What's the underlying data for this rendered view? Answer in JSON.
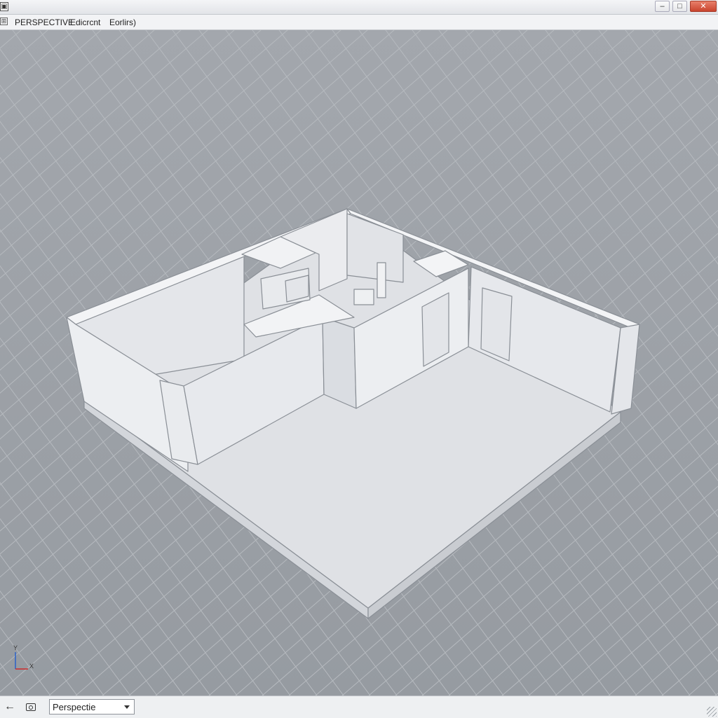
{
  "window": {
    "min_glyph": "‒",
    "max_glyph": "□",
    "close_glyph": "✕"
  },
  "toolbar": {
    "icon_glyph": "⊞",
    "view_name": "PERSPECTIVE",
    "menu_edit": "Edicrcnt",
    "menu_options": "Eorlirs)"
  },
  "viewport": {
    "axis_y": "Y",
    "axis_x": "X",
    "colors": {
      "background": "#9ea3a9",
      "grid_line": "#b6babf",
      "wall": "#e9eaee",
      "floor": "#dfe1e5",
      "edge": "#8a8f96"
    }
  },
  "statusbar": {
    "view_select_value": "Perspectie"
  }
}
